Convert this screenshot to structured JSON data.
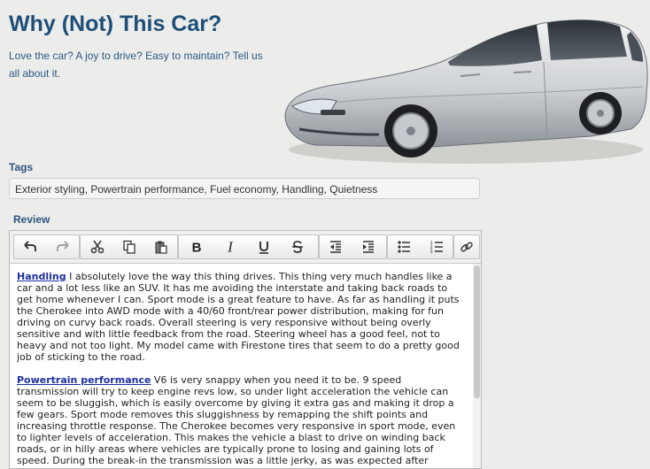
{
  "header": {
    "title": "Why (Not) This Car?",
    "intro": "Love the car? A joy to drive? Easy to maintain? Tell us all about it."
  },
  "tags": {
    "label": "Tags",
    "value": "Exterior styling, Powertrain performance, Fuel economy, Handling, Quietness"
  },
  "review": {
    "label": "Review",
    "paragraphs": [
      {
        "heading": "Handling",
        "text": " I absolutely love the way this thing drives. This thing very much handles like a car and a lot less like an SUV. It has me avoiding the interstate and taking back roads to get home whenever I can. Sport mode is a great feature to have. As far as handling it puts the Cherokee into AWD mode with a 40/60 front/rear power distribution, making for fun driving on curvy back roads. Overall steering is very responsive without being overly sensitive and with little feedback from the road. Steering wheel has a good feel, not to heavy and not too light. My model came with Firestone tires that seem to do a pretty good job of sticking to the road."
      },
      {
        "heading": "Powertrain performance",
        "text": " V6 is very snappy when you need it to be. 9 speed transmission will try to keep engine revs low, so under light acceleration the vehicle can seem to be sluggish, which is easily overcome by giving it extra gas and making it drop a few gears. Sport mode removes this sluggishness by remapping the shift points and increasing throttle response. The Cherokee becomes very responsive in sport mode, even to lighter levels of acceleration. This makes the vehicle a blast to drive on winding back roads, or in hilly areas where vehicles are typically prone to losing and gaining lots of speed. During the break-in the transmission was a little jerky, as was expected after"
      }
    ]
  },
  "toolbar": {
    "icons": [
      "undo-icon",
      "redo-icon",
      "cut-icon",
      "copy-icon",
      "paste-icon",
      "bold-icon",
      "italic-icon",
      "underline-icon",
      "strikethrough-icon",
      "outdent-icon",
      "indent-icon",
      "bulleted-list-icon",
      "numbered-list-icon",
      "link-icon"
    ]
  },
  "colors": {
    "title": "#1e4f79",
    "label": "#2b557f",
    "link": "#1d2fa3",
    "page_background": "#ececea"
  }
}
